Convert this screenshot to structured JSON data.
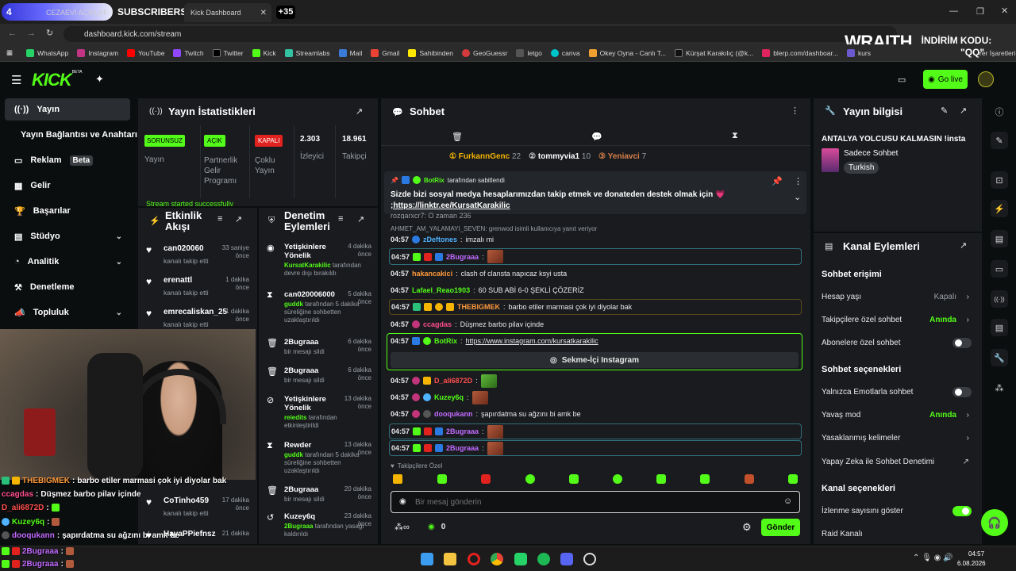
{
  "browser": {
    "tab_count": "4",
    "tab1_label": "CEZAEVİ AÇIKLAMA VİDE",
    "tab2_label": "Kick Dashboard",
    "overlay_subscribers": "SUBSCRIBERS",
    "overlay_plus_count": "+35",
    "url": "dashboard.kick.com/stream",
    "bookmarks": [
      "WhatsApp",
      "Instagram",
      "YouTube",
      "Twitch",
      "Twitter",
      "Kick",
      "Streamlabs",
      "Mail",
      "Gmail",
      "Sahibinden",
      "GeoGuessr",
      "letgo",
      "canva",
      "Okey Oyna - Canlı T...",
      "Kürşat Karakılıç (@k...",
      "blerp.com/dashboar...",
      "kurs"
    ],
    "bookmarks_end": "Yer İşaretleri",
    "sponsor_brand": "WRAITH.",
    "sponsor_text": "İNDİRİM KODU:",
    "sponsor_code": "\"QQ\""
  },
  "header": {
    "logo": "KICK",
    "logo_tag": "BETA",
    "go_live_label": "Go live"
  },
  "sidebar": {
    "items": [
      {
        "label": "Yayın",
        "icon": "broadcast-icon"
      },
      {
        "label": "Yayın Bağlantısı ve Anahtarı",
        "icon": ""
      },
      {
        "label": "Reklam",
        "badge": "Beta",
        "icon": "ad-icon"
      },
      {
        "label": "Gelir",
        "icon": "revenue-icon"
      },
      {
        "label": "Başarılar",
        "icon": "trophy-icon"
      },
      {
        "label": "Stüdyo",
        "icon": "studio-icon"
      },
      {
        "label": "Analitik",
        "icon": "analytics-icon"
      },
      {
        "label": "Denetleme",
        "icon": "moderation-icon"
      },
      {
        "label": "Topluluk",
        "icon": "community-icon"
      }
    ]
  },
  "stats": {
    "title": "Yayın İstatistikleri",
    "cards": [
      {
        "badge": "SORUNSUZ",
        "label": "Yayın"
      },
      {
        "badge": "AÇIK",
        "label": "Partnerlik Gelir Programı"
      },
      {
        "badge": "KAPALI",
        "label": "Çoklu Yayın"
      },
      {
        "value": "2.303",
        "label": "İzleyici"
      },
      {
        "value": "18.961",
        "label": "Takipçi"
      }
    ],
    "notice": "Stream started successfully"
  },
  "activity": {
    "title": "Etkinlik Akışı",
    "items": [
      {
        "user": "can020060",
        "time": "33 saniye önce",
        "desc": "kanalı takip etti"
      },
      {
        "user": "erenattl",
        "time": "1 dakika önce",
        "desc": "kanalı takip etti"
      },
      {
        "user": "emrecaliskan_25",
        "time": "1 dakika önce",
        "desc": "kanalı takip etti"
      },
      {
        "user": "CoTinho459",
        "time": "17 dakika önce",
        "desc": "kanalı takip etti"
      },
      {
        "user": "HayaPPiefnsz",
        "time": "21 dakika",
        "desc": ""
      }
    ]
  },
  "modlog": {
    "title": "Denetim Eylemleri",
    "items": [
      {
        "icon": "eye-icon",
        "title": "Yetişkinlere Yönelik",
        "time": "4 dakika önce",
        "actor": "KursatKarakilic",
        "desc": "tarafından devre dışı bırakıldı"
      },
      {
        "icon": "hourglass-icon",
        "title": "can020006000",
        "time": "5 dakika önce",
        "actor": "guddk",
        "desc": "tarafından 5 dakika süreliğine sohbetten uzaklaştırıldı"
      },
      {
        "icon": "trash-icon",
        "title": "2Bugraaa",
        "time": "6 dakika önce",
        "actor": "",
        "desc": "bir mesajı sildi"
      },
      {
        "icon": "trash-icon",
        "title": "2Bugraaa",
        "time": "6 dakika önce",
        "actor": "",
        "desc": "bir mesajı sildi"
      },
      {
        "icon": "eye-off-icon",
        "title": "Yetişkinlere Yönelik",
        "time": "13 dakika önce",
        "actor": "reiedits",
        "desc": "tarafından etkinleştirildi"
      },
      {
        "icon": "hourglass-icon",
        "title": "Rewder",
        "time": "13 dakika önce",
        "actor": "guddk",
        "desc": "tarafından 5 dakika süreliğine sohbetten uzaklaştırıldı"
      },
      {
        "icon": "trash-icon",
        "title": "2Bugraaa",
        "time": "20 dakika önce",
        "actor": "",
        "desc": "bir mesajı sildi"
      },
      {
        "icon": "history-icon",
        "title": "Kuzey6q",
        "time": "23 dakika önce",
        "actor": "2Bugraaa",
        "desc": "tarafından yasağı kaldırıldı"
      }
    ]
  },
  "chat": {
    "title": "Sohbet",
    "leaders": [
      {
        "rank": "1",
        "name": "FurkannGenc",
        "count": "22"
      },
      {
        "rank": "2",
        "name": "tommyvia1",
        "count": "10"
      },
      {
        "rank": "3",
        "name": "Yeniavci",
        "count": "7"
      }
    ],
    "pinned": {
      "author": "BotRix",
      "by": "tarafından sabitlendi",
      "text": "Sizde bizi sosyal medya hesaplarımızdan takip etmek ve donateden destek olmak için 💗",
      "link": ";https://linktr.ee/KursatKarakilic"
    },
    "partial_line": "rozgarxcr7: O zaman 236",
    "reply_hint": "AHMET_AM_YALAMAYI_SEVEN: grenwod isimli kullanıcıya yanıt veriyor",
    "messages": [
      {
        "time": "04:57",
        "user": "zDeftones",
        "color": "#4fb3ff",
        "text": "imzalı mi"
      },
      {
        "time": "04:57",
        "user": "2Bugraaa",
        "color": "#c26bff",
        "text": ""
      },
      {
        "time": "04:57",
        "user": "hakancakici",
        "color": "#ff9a3c",
        "text": "clash of clansta napıcaz ksyi usta"
      },
      {
        "time": "04:57",
        "user": "Lafael_Reao1903",
        "color": "#53fc18",
        "text": "60 SUB ABİ 6-0 ŞEKLİ ÇÖZERİZ"
      },
      {
        "time": "04:57",
        "user": "THEBIGMEK",
        "color": "#ff9a3c",
        "text": "barbo etiler marmasi çok iyi diyolar bak"
      },
      {
        "time": "04:57",
        "user": "ccagdas",
        "color": "#ff4f8b",
        "text": "Düşmez barbo pilav içinde"
      },
      {
        "time": "04:57",
        "user": "BotRix",
        "color": "#53fc18",
        "text": "https://www.instagram.com/kursatkarakilic"
      },
      {
        "time": "04:57",
        "user": "D_ali6872D",
        "color": "#ff4f4f",
        "text": ""
      },
      {
        "time": "04:57",
        "user": "Kuzey6q",
        "color": "#53fc18",
        "text": ""
      },
      {
        "time": "04:57",
        "user": "dooqukann",
        "color": "#c26bff",
        "text": "şapırdatma su ağzını bi amk be"
      },
      {
        "time": "04:57",
        "user": "2Bugraaa",
        "color": "#c26bff",
        "text": ""
      },
      {
        "time": "04:57",
        "user": "2Bugraaa",
        "color": "#c26bff",
        "text": ""
      }
    ],
    "instagram_button": "Sekme-İçi Instagram",
    "followers_only": "Takipçilere Özel",
    "input_placeholder": "Bir mesaj gönderin",
    "points": "0",
    "send_label": "Gönder"
  },
  "stream_info": {
    "title": "Yayın bilgisi",
    "stream_title": "ANTALYA YOLCUSU KALMASIN !insta",
    "category": "Sadece Sohbet",
    "tag": "Turkish"
  },
  "channel_actions": {
    "title": "Kanal Eylemleri",
    "section1": "Sohbet erişimi",
    "rows1": [
      {
        "label": "Hesap yaşı",
        "value": "Kapalı"
      },
      {
        "label": "Takipçilere özel sohbet",
        "value": "Anında"
      },
      {
        "label": "Abonelere özel sohbet",
        "value": ""
      }
    ],
    "section2": "Sohbet seçenekleri",
    "rows2": [
      {
        "label": "Yalnızca Emotlarla sohbet",
        "value": ""
      },
      {
        "label": "Yavaş mod",
        "value": "Anında"
      },
      {
        "label": "Yasaklanmış kelimeler",
        "value": ""
      },
      {
        "label": "Yapay Zeka ile Sohbet Denetimi",
        "value": ""
      }
    ],
    "section3": "Kanal seçenekleri",
    "rows3": [
      {
        "label": "İzlenme sayısını göster",
        "value": ""
      },
      {
        "label": "Raid Kanalı",
        "value": ""
      }
    ]
  },
  "overlay_chat": [
    {
      "user": "THEBIGMEK",
      "text": "barbo etiler marmasi çok iyi diyolar bak"
    },
    {
      "user": "ccagdas",
      "text": "Düşmez barbo pilav içinde"
    },
    {
      "user": "D_ali6872D",
      "text": ""
    },
    {
      "user": "Kuzey6q",
      "text": ""
    },
    {
      "user": "dooqukann",
      "text": "şapırdatma su ağzını bi amk be"
    },
    {
      "user": "2Bugraaa",
      "text": ""
    },
    {
      "user": "2Bugraaa",
      "text": ""
    }
  ],
  "taskbar": {
    "time": "04:57",
    "date": "6.08.2026"
  }
}
